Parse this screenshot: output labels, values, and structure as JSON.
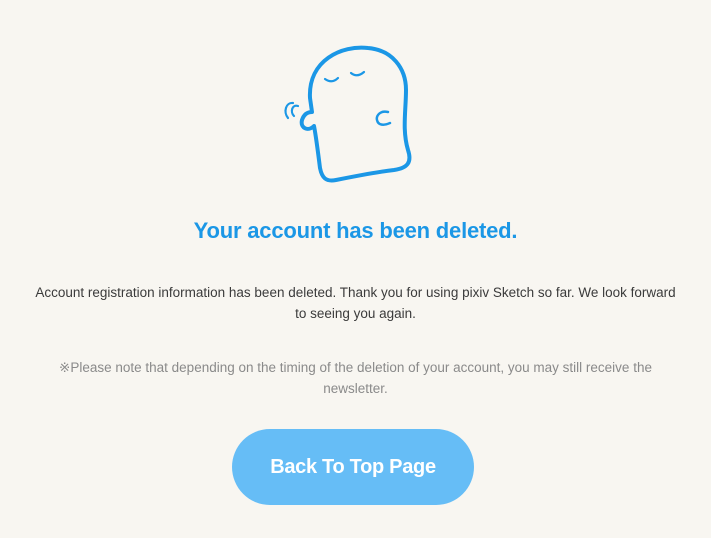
{
  "illustration": {
    "icon": "sleeping-ghost-icon",
    "color": "#1b97e6"
  },
  "heading": "Your account has been deleted.",
  "message": "Account registration information has been deleted. Thank you for using pixiv Sketch so far. We look forward to seeing you again.",
  "note": "※Please note that depending on the timing of the deletion of your account, you may still receive the newsletter.",
  "button": {
    "label": "Back To Top Page",
    "color": "#66bdf6"
  },
  "colors": {
    "background": "#f8f6f1",
    "accent": "#1b97e6",
    "body_text": "#3b3b3b",
    "note_text": "#8a8a8a"
  }
}
